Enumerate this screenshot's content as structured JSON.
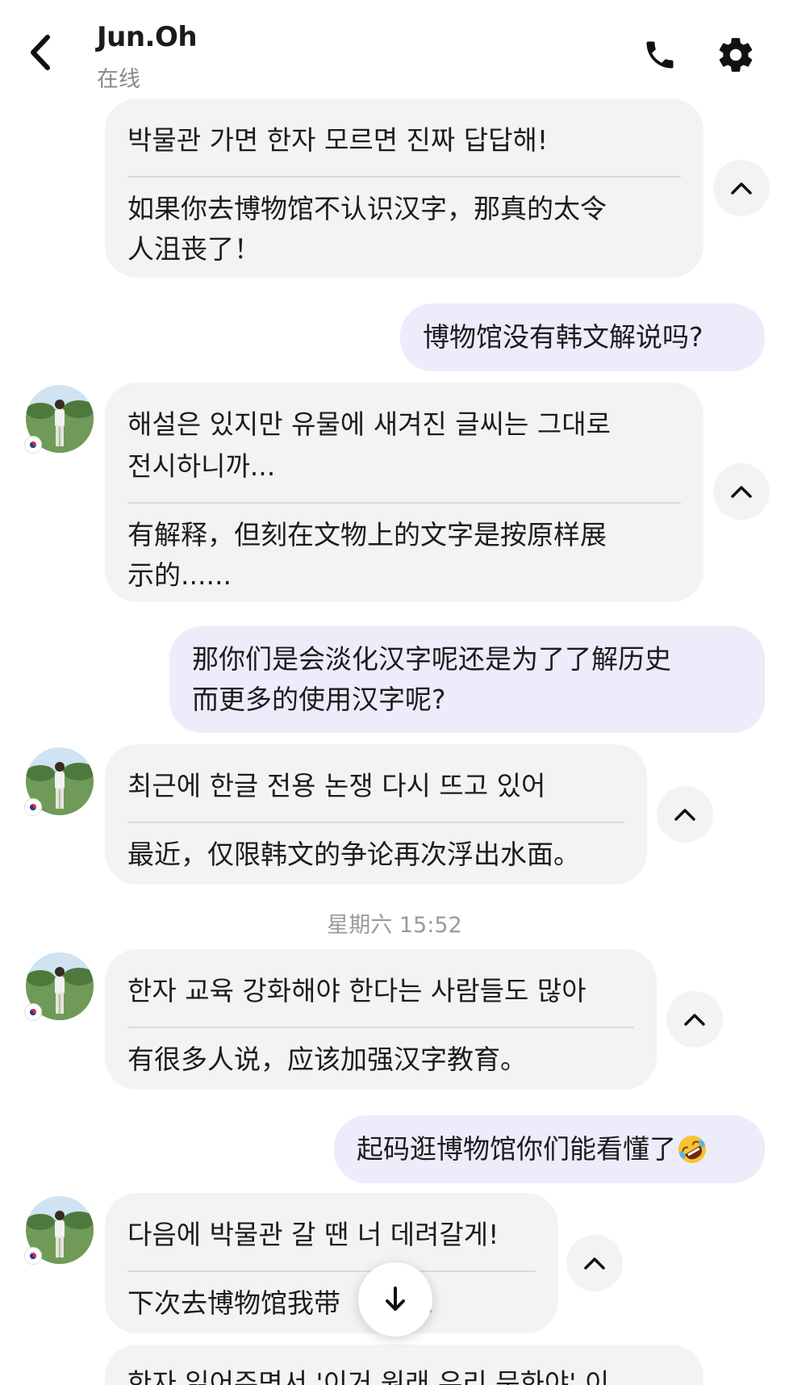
{
  "header": {
    "contact_name": "Jun.Oh",
    "status": "在线",
    "back_icon": "chevron-left-icon",
    "call_icon": "phone-icon",
    "settings_icon": "gear-icon"
  },
  "messages": [
    {
      "direction": "in",
      "original": "박물관 가면 한자 모르면 진짜 답답해!",
      "translation_l1": "如果你去博物馆不认识汉字，那真的太令",
      "translation_l2": "人沮丧了！"
    },
    {
      "direction": "out",
      "text": "博物馆没有韩文解说吗?"
    },
    {
      "direction": "in",
      "original_l1": "해설은 있지만 유물에 새겨진 글씨는 그대로",
      "original_l2": "전시하니까...",
      "translation_l1": "有解释，但刻在文物上的文字是按原样展",
      "translation_l2": "示的......"
    },
    {
      "direction": "out",
      "text_l1": "那你们是会淡化汉字呢还是为了了解历史",
      "text_l2": "而更多的使用汉字呢?"
    },
    {
      "direction": "in",
      "original": "최근에 한글 전용 논쟁 다시 뜨고 있어",
      "translation": "最近，仅限韩文的争论再次浮出水面。"
    },
    {
      "direction": "in",
      "original": "한자 교육 강화해야 한다는 사람들도 많아",
      "translation": "有很多人说，应该加强汉字教育。"
    },
    {
      "direction": "out",
      "text": "起码逛博物馆你们能看懂了",
      "emoji": "rolling-on-floor-laughing"
    },
    {
      "direction": "in",
      "original": "다음에 박물관 갈 땐 너 데려갈게!",
      "translation_visible": "下次去博物馆我带",
      "translation_tail": "!"
    },
    {
      "direction": "in",
      "original_partial": "한자 읽어주면서 '이거 원래 우리 문화야' 이"
    }
  ],
  "timestamp_divider": "星期六 15:52",
  "scroll_down_icon": "arrow-down-icon",
  "colors": {
    "incoming_bubble": "#f4f2f5",
    "outgoing_bubble": "#ececfb",
    "secondary_text": "#8a8a8e"
  }
}
